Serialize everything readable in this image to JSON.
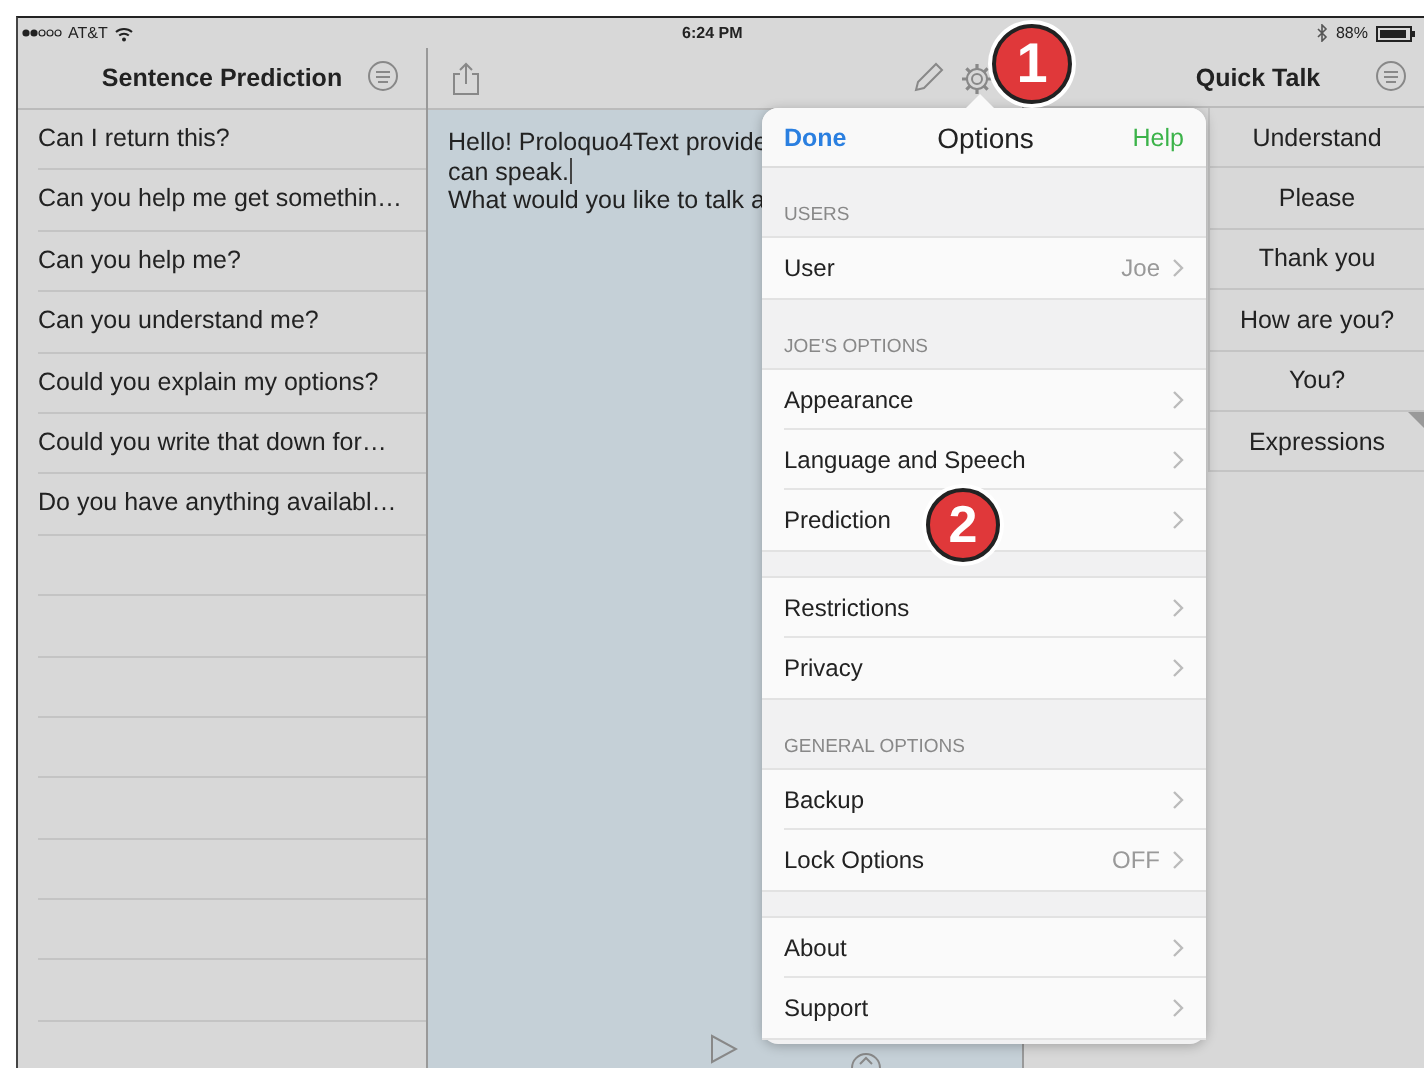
{
  "status_bar": {
    "carrier": "AT&T",
    "time": "6:24 PM",
    "battery": "88%"
  },
  "sentence_panel": {
    "title": "Sentence Prediction",
    "items": [
      "Can I return this?",
      "Can you help me get somethin…",
      "Can you help me?",
      "Can you understand me?",
      "Could you explain my options?",
      "Could you write that down for…",
      "Do you have anything availabl…"
    ]
  },
  "editor": {
    "lines": [
      "Hello! Proloquo4Text provide",
      "can speak.",
      "What would you like to talk a"
    ]
  },
  "quick_talk": {
    "title": "Quick Talk",
    "items": [
      {
        "label": "Understand",
        "kind": "phrase"
      },
      {
        "label": "Please",
        "kind": "phrase"
      },
      {
        "label": "Thank you",
        "kind": "phrase"
      },
      {
        "label": "How are you?",
        "kind": "phrase"
      },
      {
        "label": "You?",
        "kind": "phrase"
      },
      {
        "label": "Expressions",
        "kind": "folder"
      }
    ]
  },
  "options": {
    "done": "Done",
    "title": "Options",
    "help": "Help",
    "groups": [
      {
        "header": "USERS",
        "rows": [
          {
            "label": "User",
            "value": "Joe"
          }
        ]
      },
      {
        "header": "JOE'S OPTIONS",
        "rows": [
          {
            "label": "Appearance"
          },
          {
            "label": "Language and Speech"
          },
          {
            "label": "Prediction"
          }
        ]
      },
      {
        "rows": [
          {
            "label": "Restrictions"
          },
          {
            "label": "Privacy"
          }
        ]
      },
      {
        "header": "GENERAL OPTIONS",
        "rows": [
          {
            "label": "Backup"
          },
          {
            "label": "Lock Options",
            "value": "OFF"
          }
        ]
      },
      {
        "rows": [
          {
            "label": "About"
          },
          {
            "label": "Support"
          }
        ]
      }
    ]
  },
  "callouts": [
    "1",
    "2"
  ]
}
